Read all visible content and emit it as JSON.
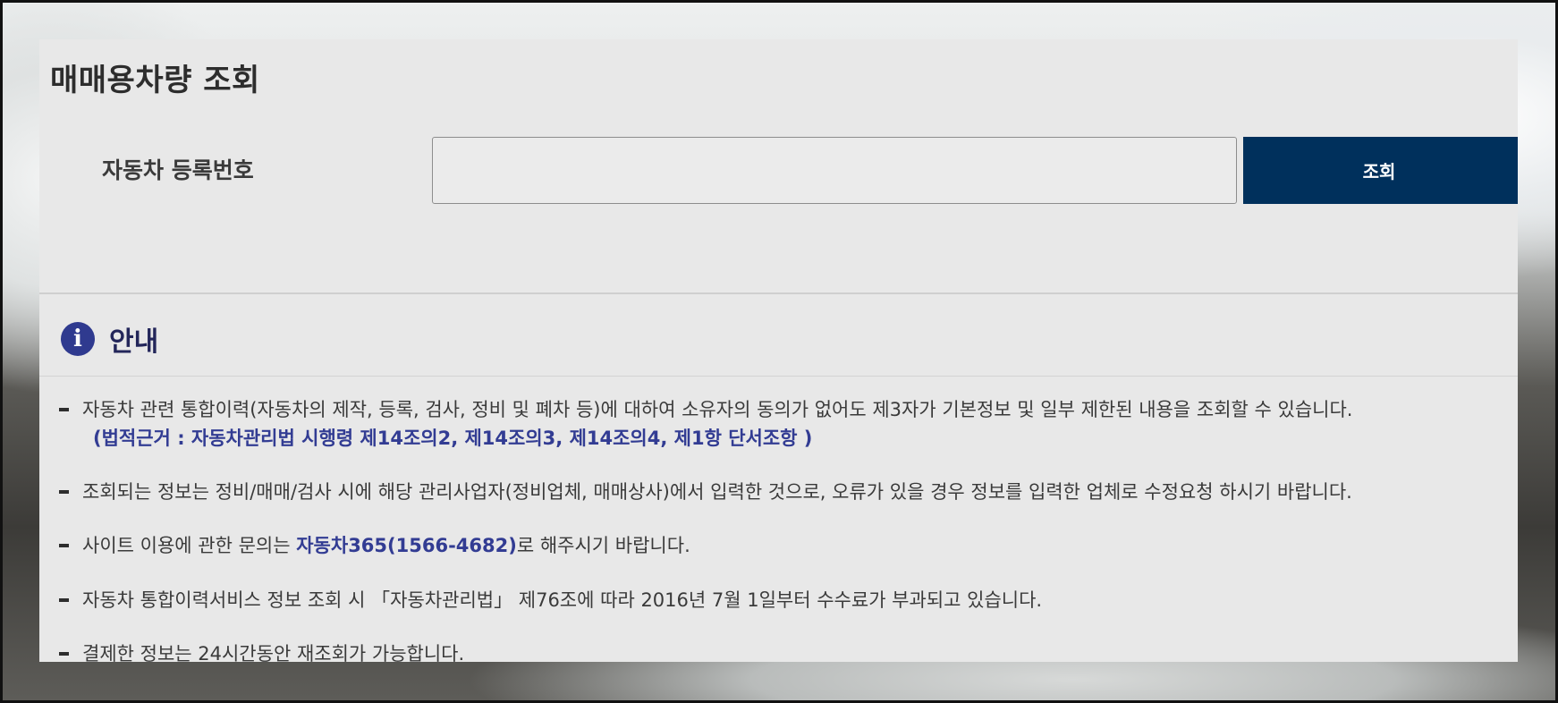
{
  "page_title": "매매용차량 조회",
  "search": {
    "label": "자동차 등록번호",
    "value": "",
    "button_label": "조회"
  },
  "notice": {
    "title": "안내",
    "items": [
      {
        "text": "자동차 관련 통합이력(자동차의 제작, 등록, 검사, 정비 및 폐차 등)에 대하여 소유자의 동의가 없어도 제3자가 기본정보 및 일부 제한된 내용을 조회할 수 있습니다.",
        "legal_basis": "(법적근거 : 자동차관리법 시행령 제14조의2, 제14조의3, 제14조의4, 제1항 단서조항 )"
      },
      {
        "text": "조회되는 정보는 정비/매매/검사 시에 해당 관리사업자(정비업체, 매매상사)에서 입력한 것으로, 오류가 있을 경우 정보를 입력한 업체로 수정요청 하시기 바랍니다."
      },
      {
        "text_before": "사이트 이용에 관한 문의는 ",
        "highlight": "자동차365(1566-4682)",
        "text_after": "로 해주시기 바랍니다."
      },
      {
        "text": "자동차 통합이력서비스 정보 조회 시 「자동차관리법」 제76조에 따라 2016년 7월 1일부터 수수료가 부과되고 있습니다."
      },
      {
        "text": "결제한 정보는 24시간동안 재조회가 가능합니다."
      }
    ]
  },
  "colors": {
    "button_bg": "#00305c",
    "accent_text": "#323c93",
    "panel_bg": "#e8e8e8"
  },
  "icons": {
    "notice_icon": "info-circle-icon",
    "bullet": "dash-bullet"
  }
}
